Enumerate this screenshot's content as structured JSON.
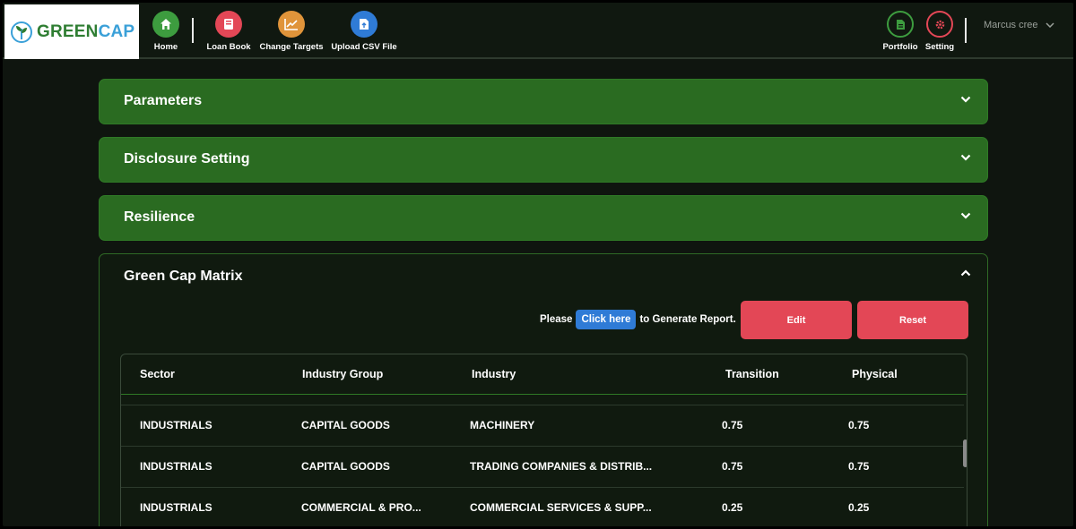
{
  "brand": {
    "part1": "GREEN",
    "part2": "CAP"
  },
  "nav": [
    {
      "label": "Home",
      "icon": "home-icon",
      "color": "#3d9c3f"
    },
    {
      "label": "Loan Book",
      "icon": "book-icon",
      "color": "#e34756"
    },
    {
      "label": "Change Targets",
      "icon": "chart-line-icon",
      "color": "#e0943a"
    },
    {
      "label": "Upload CSV File",
      "icon": "file-upload-icon",
      "color": "#2f7bd6"
    }
  ],
  "right_nav": [
    {
      "label": "Portfolio",
      "icon": "document-icon",
      "color": "#3d9c3f"
    },
    {
      "label": "Setting",
      "icon": "gear-icon",
      "color": "#e34756"
    }
  ],
  "user": {
    "name": "Marcus cree"
  },
  "accordions": [
    {
      "title": "Parameters"
    },
    {
      "title": "Disclosure Setting"
    },
    {
      "title": "Resilience"
    }
  ],
  "matrix": {
    "title": "Green Cap Matrix",
    "prompt_before": "Please",
    "click_label": "Click here",
    "prompt_after": "to Generate Report.",
    "edit_label": "Edit",
    "reset_label": "Reset",
    "columns": [
      "Sector",
      "Industry Group",
      "Industry",
      "Transition",
      "Physical"
    ],
    "rows": [
      [
        "INDUSTRIALS",
        "CAPITAL GOODS",
        "MACHINERY",
        "0.75",
        "0.75"
      ],
      [
        "INDUSTRIALS",
        "CAPITAL GOODS",
        "TRADING COMPANIES & DISTRIB...",
        "0.75",
        "0.75"
      ],
      [
        "INDUSTRIALS",
        "COMMERCIAL & PRO...",
        "COMMERCIAL SERVICES & SUPP...",
        "0.25",
        "0.25"
      ]
    ]
  },
  "colors": {
    "accordion": "#2a6b21",
    "danger": "#e34756",
    "primary": "#2f7bd6",
    "background": "#0f150f"
  }
}
